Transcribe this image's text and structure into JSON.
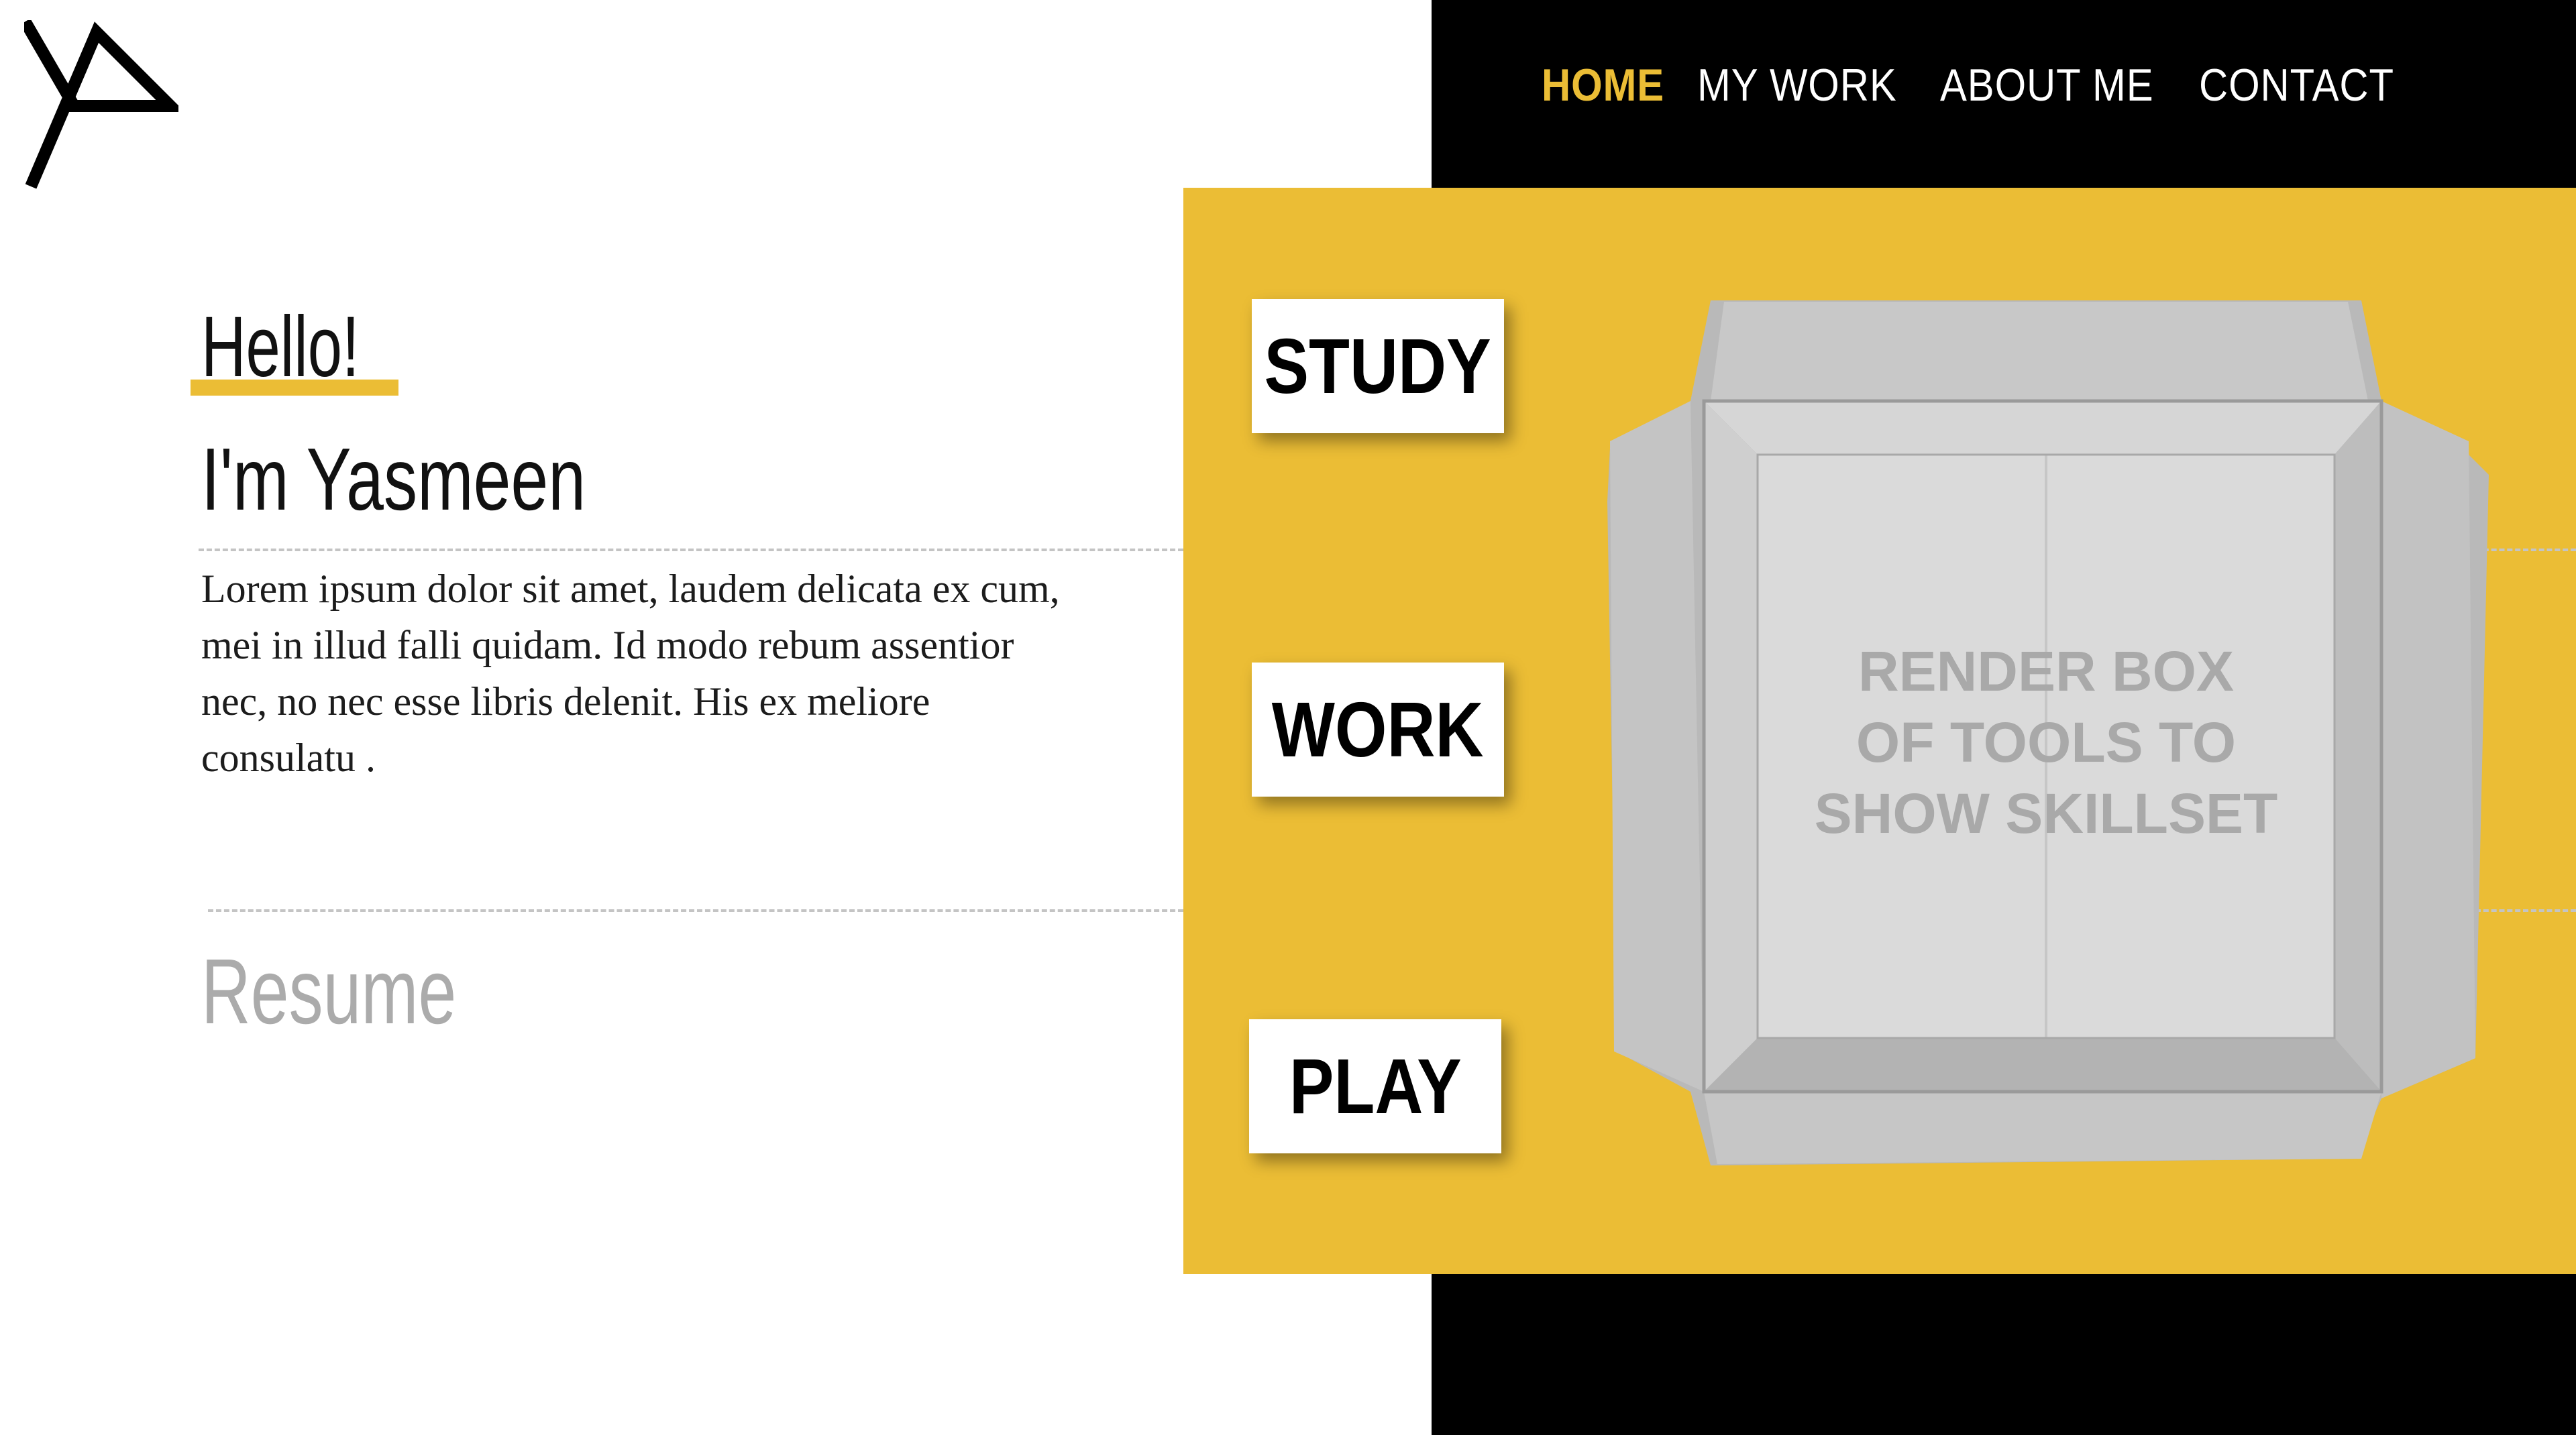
{
  "brand": {
    "logo_icon": "yp-monogram-logo"
  },
  "nav": {
    "items": [
      {
        "label": "HOME",
        "active": true
      },
      {
        "label": "MY WORK",
        "active": false
      },
      {
        "label": "ABOUT ME",
        "active": false
      },
      {
        "label": "CONTACT",
        "active": false
      }
    ]
  },
  "hero": {
    "greeting": "Hello!",
    "name": "I'm Yasmeen",
    "intro": "Lorem ipsum dolor sit amet, laudem delicata ex cum, mei in illud falli quidam. Id modo rebum assentior nec, no nec esse libris delenit. His ex meliore consulatu .",
    "resume_link": "Resume"
  },
  "categories": [
    {
      "label": "STUDY"
    },
    {
      "label": "WORK"
    },
    {
      "label": "PLAY"
    }
  ],
  "toolbox": {
    "icon": "open-cardboard-box-icon",
    "caption": "RENDER BOX OF TOOLS TO SHOW SKILLSET"
  },
  "colors": {
    "accent": "#EBBD35",
    "nav_active": "#EBBD35",
    "panel_dark": "#000000",
    "text_dark": "#111111",
    "resume_gray": "#ABABAB"
  }
}
